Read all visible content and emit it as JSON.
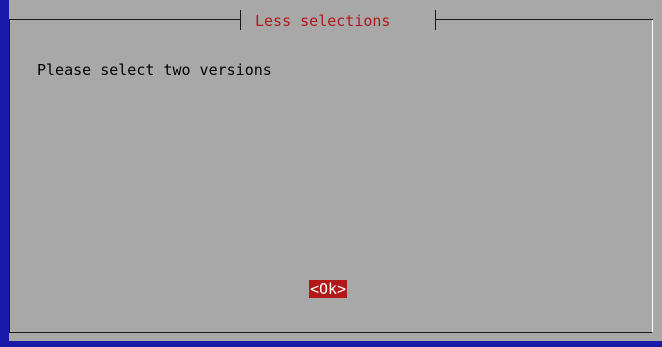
{
  "dialog": {
    "title": "Less selections",
    "message": "Please select two versions",
    "ok_label": "<Ok>"
  },
  "colors": {
    "background": "#1a1aa8",
    "dialog": "#a8a8a8",
    "accent": "#b21818"
  }
}
